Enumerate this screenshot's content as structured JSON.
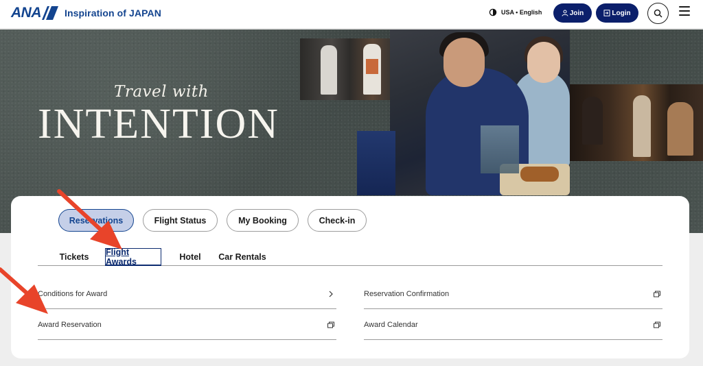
{
  "header": {
    "logo_text": "ANA",
    "tagline": "Inspiration of JAPAN",
    "locale_label": "USA • English",
    "join_label": "Join",
    "login_label": "Login"
  },
  "hero": {
    "subtitle": "Travel with",
    "title": "INTENTION"
  },
  "booking": {
    "main_tabs": [
      {
        "label": "Reservations",
        "active": true
      },
      {
        "label": "Flight Status",
        "active": false
      },
      {
        "label": "My Booking",
        "active": false
      },
      {
        "label": "Check-in",
        "active": false
      }
    ],
    "sub_tabs": [
      {
        "label": "Tickets",
        "active": false
      },
      {
        "label": "Flight Awards",
        "active": true
      },
      {
        "label": "Hotel",
        "active": false
      },
      {
        "label": "Car Rentals",
        "active": false
      }
    ],
    "links_left": [
      {
        "label": "Conditions for Award",
        "icon": "chevron-right-icon"
      },
      {
        "label": "Award Reservation",
        "icon": "external-window-icon"
      }
    ],
    "links_right": [
      {
        "label": "Reservation Confirmation",
        "icon": "external-window-icon"
      },
      {
        "label": "Award Calendar",
        "icon": "external-window-icon"
      }
    ]
  },
  "colors": {
    "brand_blue": "#13448f",
    "navy_button": "#0b1f6b",
    "active_tab_fill": "#c5cfe8",
    "annotation_red": "#e8442a"
  }
}
